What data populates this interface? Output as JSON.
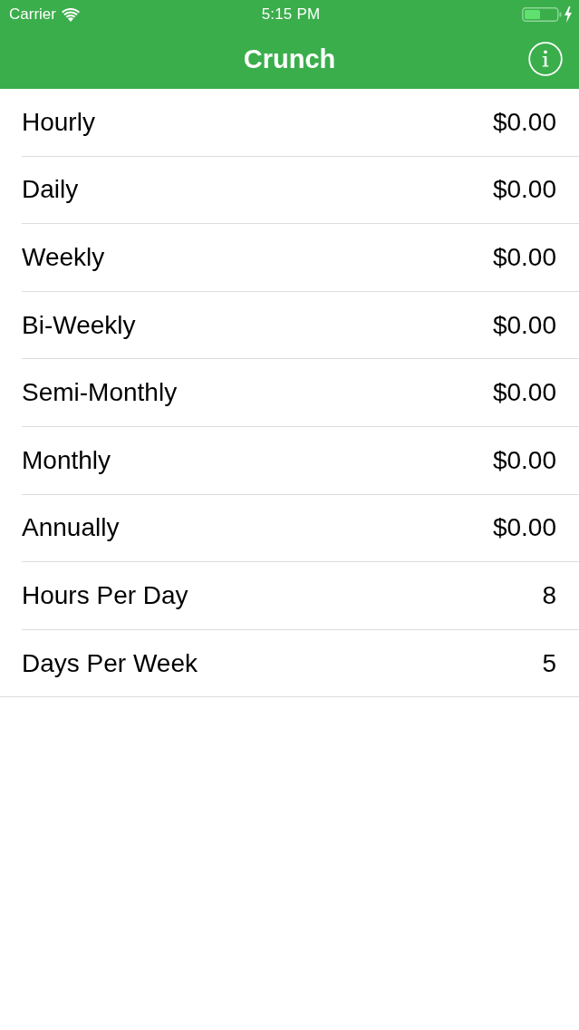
{
  "status_bar": {
    "carrier": "Carrier",
    "time": "5:15 PM"
  },
  "nav_bar": {
    "title": "Crunch"
  },
  "rows": [
    {
      "label": "Hourly",
      "value": "$0.00"
    },
    {
      "label": "Daily",
      "value": "$0.00"
    },
    {
      "label": "Weekly",
      "value": "$0.00"
    },
    {
      "label": "Bi-Weekly",
      "value": "$0.00"
    },
    {
      "label": "Semi-Monthly",
      "value": "$0.00"
    },
    {
      "label": "Monthly",
      "value": "$0.00"
    },
    {
      "label": "Annually",
      "value": "$0.00"
    },
    {
      "label": "Hours Per Day",
      "value": "8"
    },
    {
      "label": "Days Per Week",
      "value": "5"
    }
  ]
}
